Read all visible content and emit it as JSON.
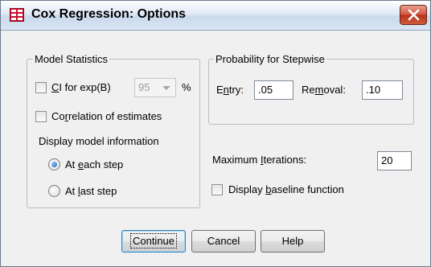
{
  "window": {
    "title": "Cox Regression: Options"
  },
  "model_statistics": {
    "legend": "Model Statistics",
    "ci": {
      "label_mnemonic": "C",
      "label_rest": "I for exp(B)",
      "checked": false,
      "value": "95",
      "unit": "%",
      "enabled": false
    },
    "correlation": {
      "label_before": "Co",
      "label_mnemonic": "r",
      "label_after": "relation of estimates",
      "checked": false
    },
    "display_heading": "Display model information",
    "at_each_step": {
      "label_before": "At ",
      "label_mnemonic": "e",
      "label_after": "ach step",
      "selected": true
    },
    "at_last_step": {
      "label_before": "At ",
      "label_mnemonic": "l",
      "label_after": "ast step",
      "selected": false
    }
  },
  "stepwise": {
    "legend": "Probability for Stepwise",
    "entry": {
      "label_before": "E",
      "label_mnemonic": "n",
      "label_after": "try:",
      "value": ".05"
    },
    "removal": {
      "label_before": "Re",
      "label_mnemonic": "m",
      "label_after": "oval:",
      "value": ".10"
    }
  },
  "max_iterations": {
    "label_before": "Maximum ",
    "label_mnemonic": "I",
    "label_after": "terations:",
    "value": "20"
  },
  "baseline": {
    "label_before": "Display ",
    "label_mnemonic": "b",
    "label_after": "aseline function",
    "checked": false
  },
  "buttons": {
    "continue_label": "Continue",
    "cancel_label": "Cancel",
    "help_label": "Help"
  },
  "icons": {
    "app": "table-grid-icon",
    "close": "close-icon",
    "dropdown": "chevron-down-icon"
  },
  "colors": {
    "app_icon": "#c8102e",
    "close_button": "#c74a2e",
    "selection": "#1d5fc5"
  }
}
